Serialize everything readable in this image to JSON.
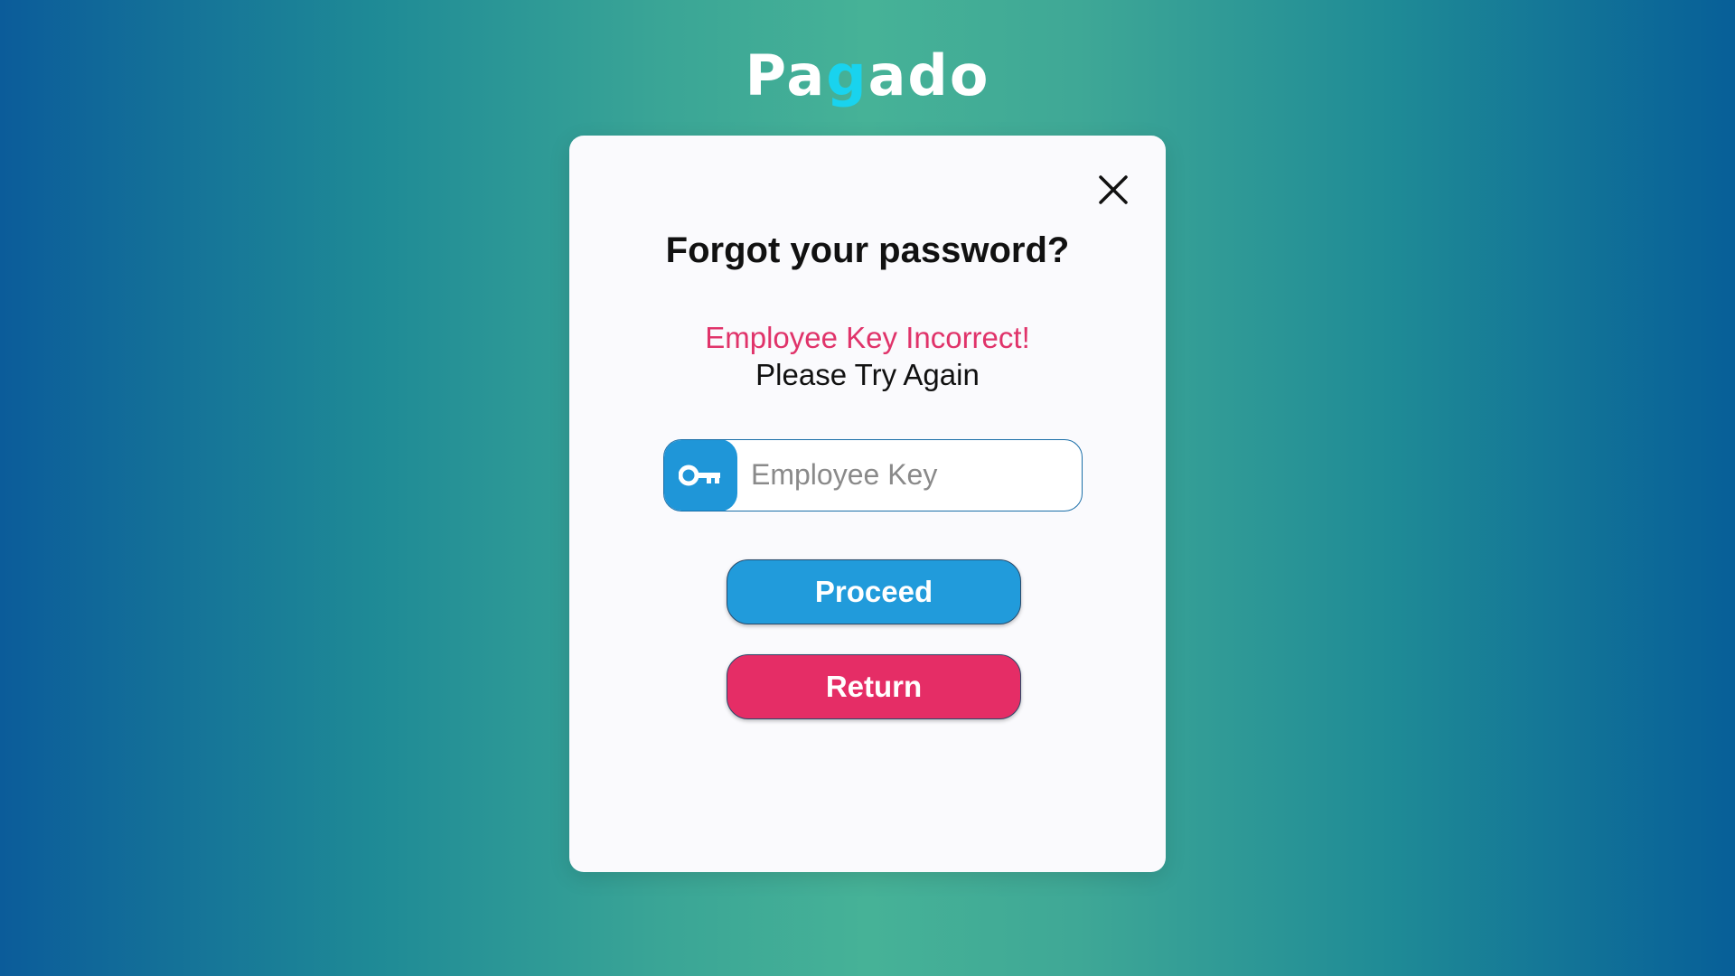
{
  "brand": {
    "logo_prefix": "Pa",
    "logo_accent": "g",
    "logo_suffix": "ado",
    "accent_color": "#19d3ee"
  },
  "dialog": {
    "title": "Forgot your password?",
    "error_message": "Employee Key Incorrect!",
    "retry_message": "Please Try Again",
    "close_icon": "close-icon",
    "key_icon": "key-icon",
    "key_input": {
      "placeholder": "Employee Key",
      "value": ""
    },
    "proceed_label": "Proceed",
    "return_label": "Return"
  },
  "colors": {
    "error": "#e0336a",
    "primary": "#219bdb",
    "danger": "#e52d66"
  }
}
